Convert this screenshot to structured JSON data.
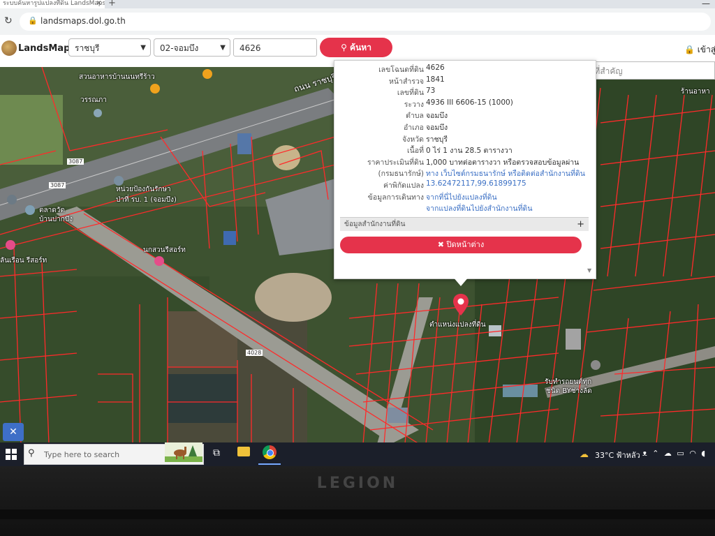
{
  "browser": {
    "tab_title": "ระบบค้นหารูปแปลงที่ดิน LandsMaps กรมที่ดิน",
    "new_tab": "+",
    "url": "landsmaps.dol.go.th"
  },
  "header": {
    "logo_text": "LandsMaps",
    "province": "ราชบุรี",
    "district": "02-จอมบึง",
    "parcel_number": "4626",
    "search_button": "ค้นหา",
    "login": "เข้าสู่ร"
  },
  "landmark_search": {
    "placeholder": "ค้นหาสถานที่สำคัญ"
  },
  "parcel_info": {
    "rows": [
      {
        "label": "เลขโฉนดที่ดิน",
        "value": "4626"
      },
      {
        "label": "หน้าสำรวจ",
        "value": "1841"
      },
      {
        "label": "เลขที่ดิน",
        "value": "73"
      },
      {
        "label": "ระวาง",
        "value": "4936 III 6606-15 (1000)"
      },
      {
        "label": "ตำบล",
        "value": "จอมบึง"
      },
      {
        "label": "อำเภอ",
        "value": "จอมบึง"
      },
      {
        "label": "จังหวัด",
        "value": "ราชบุรี"
      },
      {
        "label": "เนื้อที่",
        "value": "0 ไร่ 1 งาน 28.5 ตารางวา"
      },
      {
        "label": "ราคาประเมินที่ดิน",
        "value": "1,000 บาทต่อตารางวา หรือตรวจสอบข้อมูลผ่าน"
      },
      {
        "label": "(กรมธนารักษ์)",
        "value": "ทาง เว็บไซต์กรมธนารักษ์ หรือติดต่อสำนักงานที่ดิน"
      },
      {
        "label": "ค่าพิกัดแปลง",
        "value": "13.62472117,99.61899175"
      },
      {
        "label": "ข้อมูลการเดินทาง",
        "value": "จากที่นี่ไปยังแปลงที่ดิน"
      },
      {
        "label": "",
        "value": "จากแปลงที่ดินไปยังสำนักงานที่ดิน"
      }
    ],
    "office_section": "ข้อมูลสำนักงานที่ดิน",
    "office_expand": "+",
    "close_button": "✖ ปิดหน้าต่าง"
  },
  "map_labels": {
    "road_name": "ถนน ราชบุรี",
    "restaurant": "สวนอาหารบ้านนนทรีร้าว",
    "place_1": "วรรณภา",
    "hwy_3087a": "3087",
    "hwy_3087b": "3087",
    "hwy_4028": "4028",
    "protection_unit": "หน่วยป้องกันรักษา",
    "forest_unit": "ป่าที่ รบ. 1 (จอมบึง)",
    "bird_resort": "นกสวนรีสอร์ท",
    "home_resort": "ลันเรือน รีสอร์ท",
    "market": "ตลาดวัด",
    "village": "บ้านปากบึง",
    "shop_right": "ร้านอาหา",
    "parcel_marker": "ตำแหน่งแปลงที่ดิน",
    "garage": "รับทำรถยนต์ทุก",
    "garage_2": "ชนิด BYช่างลัด"
  },
  "taskbar": {
    "search_placeholder": "Type here to search",
    "weather": "33°C ฟ้าหลัว"
  },
  "laptop": {
    "brand": "LEGION"
  },
  "colors": {
    "accent": "#e5334b",
    "parcel_lines": "#ff2a2a"
  }
}
